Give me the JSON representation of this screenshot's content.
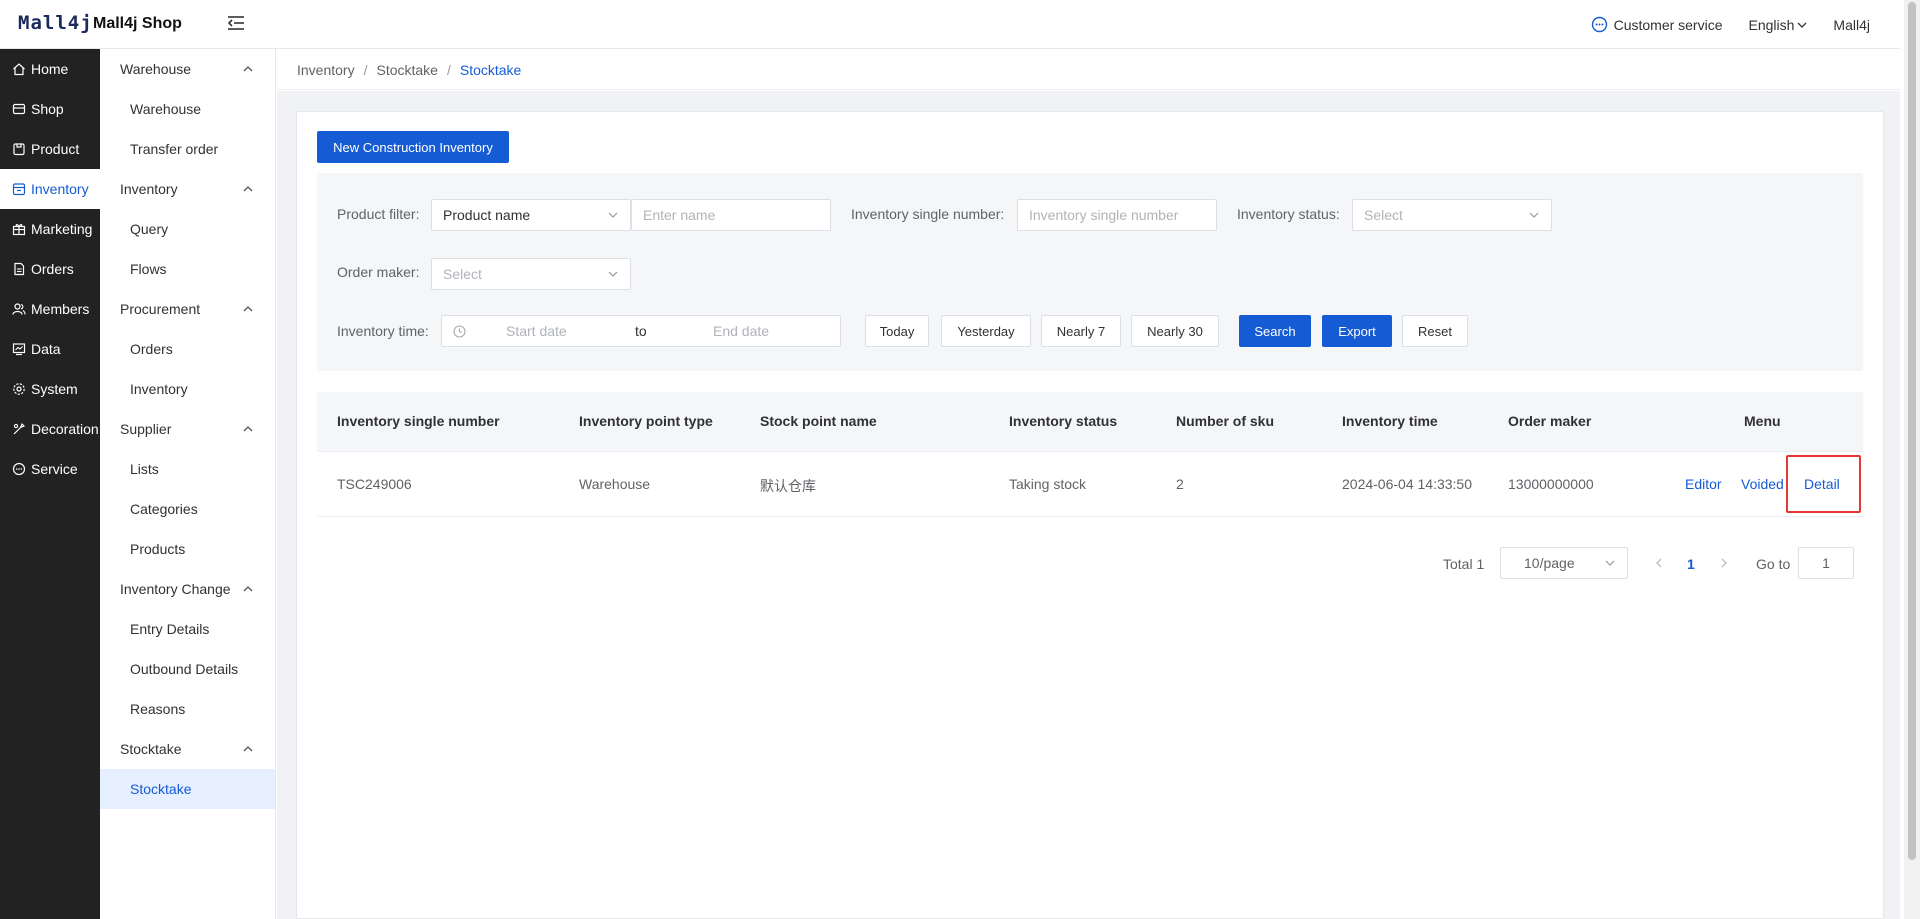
{
  "header": {
    "logo": "Mall4j",
    "shop_name": "Mall4j Shop",
    "customer_service": "Customer service",
    "language": "English",
    "user": "Mall4j"
  },
  "main_nav": [
    {
      "label": "Home",
      "icon": "home-icon"
    },
    {
      "label": "Shop",
      "icon": "shop-icon"
    },
    {
      "label": "Product",
      "icon": "product-icon"
    },
    {
      "label": "Inventory",
      "icon": "inventory-icon",
      "active": true
    },
    {
      "label": "Marketing",
      "icon": "gift-icon"
    },
    {
      "label": "Orders",
      "icon": "orders-icon"
    },
    {
      "label": "Members",
      "icon": "members-icon"
    },
    {
      "label": "Data",
      "icon": "data-icon"
    },
    {
      "label": "System",
      "icon": "gear-icon"
    },
    {
      "label": "Decoration",
      "icon": "decoration-icon"
    },
    {
      "label": "Service",
      "icon": "chat-icon"
    }
  ],
  "sub_nav": {
    "groups": [
      "Warehouse",
      "Inventory",
      "Procurement",
      "Supplier",
      "Inventory Change",
      "Stocktake"
    ],
    "items": [
      "Warehouse",
      "Transfer order",
      "Query",
      "Flows",
      "Orders",
      "Inventory",
      "Lists",
      "Categories",
      "Products",
      "Entry Details",
      "Outbound Details",
      "Reasons",
      "Stocktake"
    ]
  },
  "breadcrumb": [
    "Inventory",
    "Stocktake",
    "Stocktake"
  ],
  "toolbar": {
    "new_button": "New Construction Inventory"
  },
  "filters": {
    "product_filter_label": "Product filter:",
    "product_filter_type": "Product name",
    "product_name_placeholder": "Enter name",
    "single_number_label": "Inventory single number:",
    "single_number_placeholder": "Inventory single number",
    "status_label": "Inventory status:",
    "status_placeholder": "Select",
    "order_maker_label": "Order maker:",
    "order_maker_placeholder": "Select",
    "time_label": "Inventory time:",
    "start_placeholder": "Start date",
    "to": "to",
    "end_placeholder": "End date",
    "quick_dates": [
      "Today",
      "Yesterday",
      "Nearly 7",
      "Nearly 30"
    ],
    "search": "Search",
    "export": "Export",
    "reset": "Reset"
  },
  "table": {
    "columns": [
      "Inventory single number",
      "Inventory point type",
      "Stock point name",
      "Inventory status",
      "Number of sku",
      "Inventory time",
      "Order maker",
      "Menu"
    ],
    "rows": [
      {
        "number": "TSC249006",
        "point_type": "Warehouse",
        "point_name": "默认仓库",
        "status": "Taking stock",
        "sku": "2",
        "time": "2024-06-04 14:33:50",
        "maker": "13000000000",
        "actions": [
          "Editor",
          "Voided",
          "Detail"
        ]
      }
    ]
  },
  "pagination": {
    "total": "Total 1",
    "page_size": "10/page",
    "current_page": "1",
    "goto_label": "Go to",
    "goto_value": "1"
  },
  "colors": {
    "primary": "#155bd4",
    "nav_bg": "#222222",
    "highlight": "#e53935"
  }
}
